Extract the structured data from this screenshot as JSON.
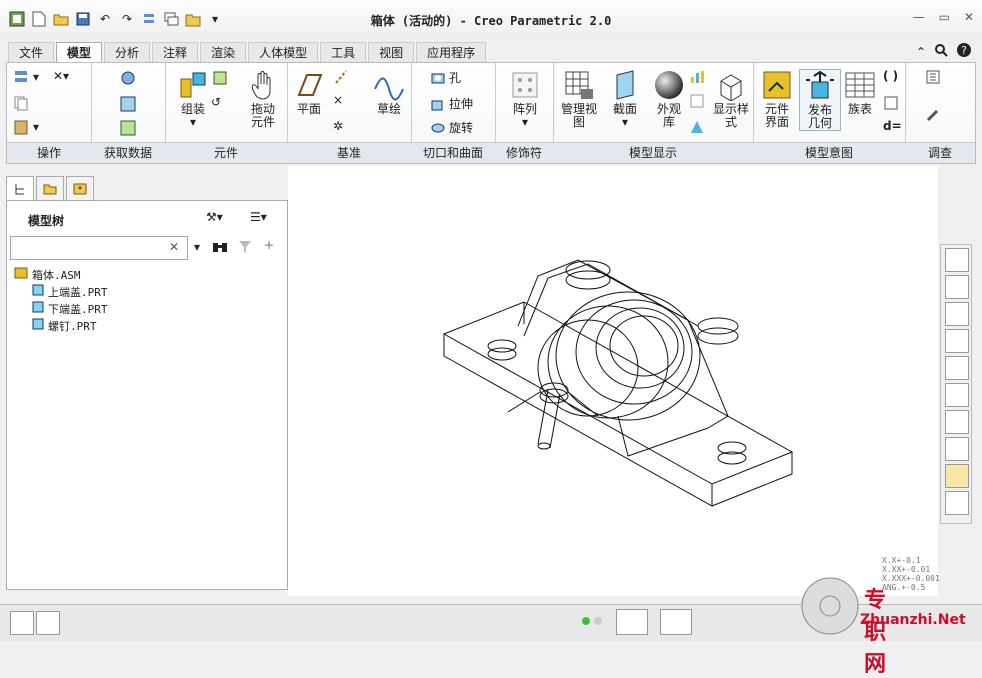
{
  "window": {
    "title": "箱体 (活动的) - Creo Parametric 2.0"
  },
  "tabs": [
    "文件",
    "模型",
    "分析",
    "注释",
    "渲染",
    "人体模型",
    "工具",
    "视图",
    "应用程序"
  ],
  "active_tab": "模型",
  "ribbon": {
    "groups": {
      "ops": "操作",
      "data": "获取数据",
      "component": "元件",
      "datum": "基准",
      "cut": "切口和曲面",
      "modifier": "修饰符",
      "display": "模型显示",
      "intent": "模型意图",
      "inspect": "调查"
    },
    "buttons": {
      "assemble": "组装",
      "drag": "拖动\n元件",
      "plane": "平面",
      "sketch": "草绘",
      "hole": "孔",
      "extrude": "拉伸",
      "revolve": "旋转",
      "pattern": "阵列",
      "manage": "管理视\n图",
      "section": "截面",
      "appearance": "外观\n库",
      "display_style": "显示样\n式",
      "component_interface": "元件\n界面",
      "publish": "发布\n几何",
      "table": "族表"
    }
  },
  "model_tree": {
    "title": "模型树",
    "search_placeholder": "",
    "items": [
      {
        "label": "箱体.ASM",
        "indent": 0
      },
      {
        "label": "上端盖.PRT",
        "indent": 1
      },
      {
        "label": "下端盖.PRT",
        "indent": 1
      },
      {
        "label": "螺钉.PRT",
        "indent": 1
      }
    ]
  },
  "tolerance": [
    "X.X+-0.1",
    "X.XX+-0.01",
    "X.XXX+-0.001",
    "ANG.+-0.5"
  ],
  "watermark": {
    "cn": "专职网",
    "url": "Zhuanzhi.Net"
  },
  "colors": {
    "accent": "#2a7bbf",
    "icon_yellow": "#e8c02a",
    "watermark": "#c8102e"
  }
}
